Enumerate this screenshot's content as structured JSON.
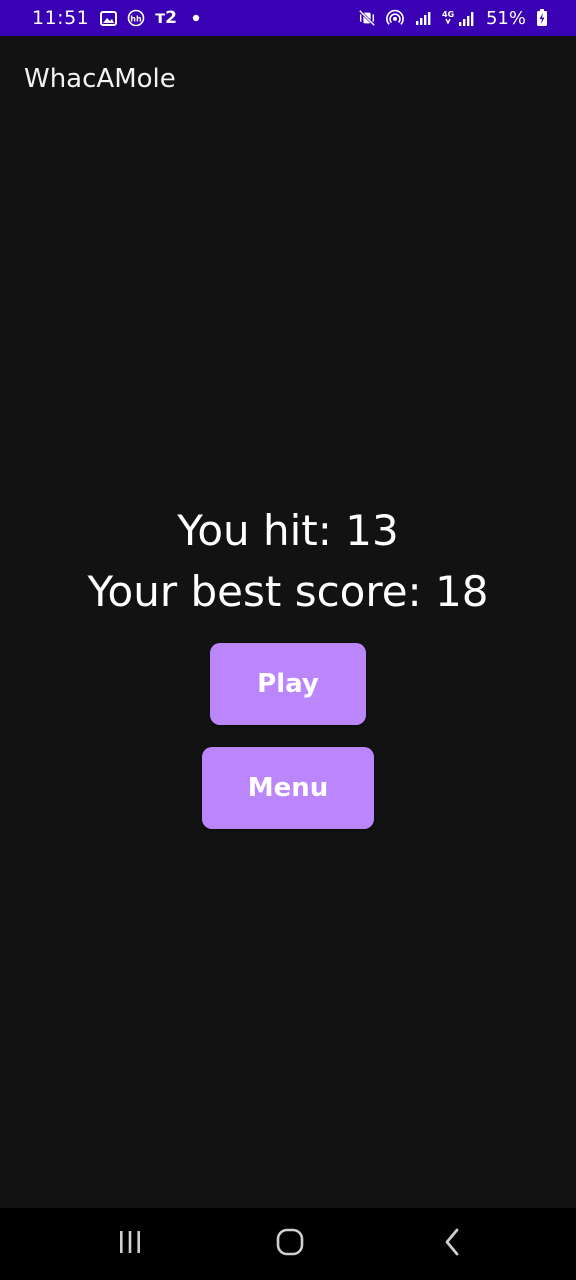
{
  "status_bar": {
    "time": "11:51",
    "carrier_badge": "т2",
    "network_label": "4G",
    "battery_percent": "51%"
  },
  "app_bar": {
    "title": "WhacAMole"
  },
  "results": {
    "hit_label": "You hit:",
    "hit_value": "13",
    "best_label": "Your best score:",
    "best_value": "18"
  },
  "buttons": {
    "play_label": "Play",
    "menu_label": "Menu"
  },
  "icons": {
    "status_left": [
      "gallery-icon",
      "hh-app-icon",
      "t2-carrier-icon",
      "notification-dot-icon"
    ],
    "status_right": [
      "mute-vibrate-icon",
      "hotspot-icon",
      "signal-icon",
      "4g-signal-icon",
      "battery-charging-icon"
    ],
    "nav": [
      "recents-icon",
      "home-icon",
      "back-icon"
    ]
  },
  "colors": {
    "status_bar_bg": "#3a00b3",
    "background": "#121212",
    "button_bg": "#bb86fc",
    "nav_bar_bg": "#000000"
  }
}
